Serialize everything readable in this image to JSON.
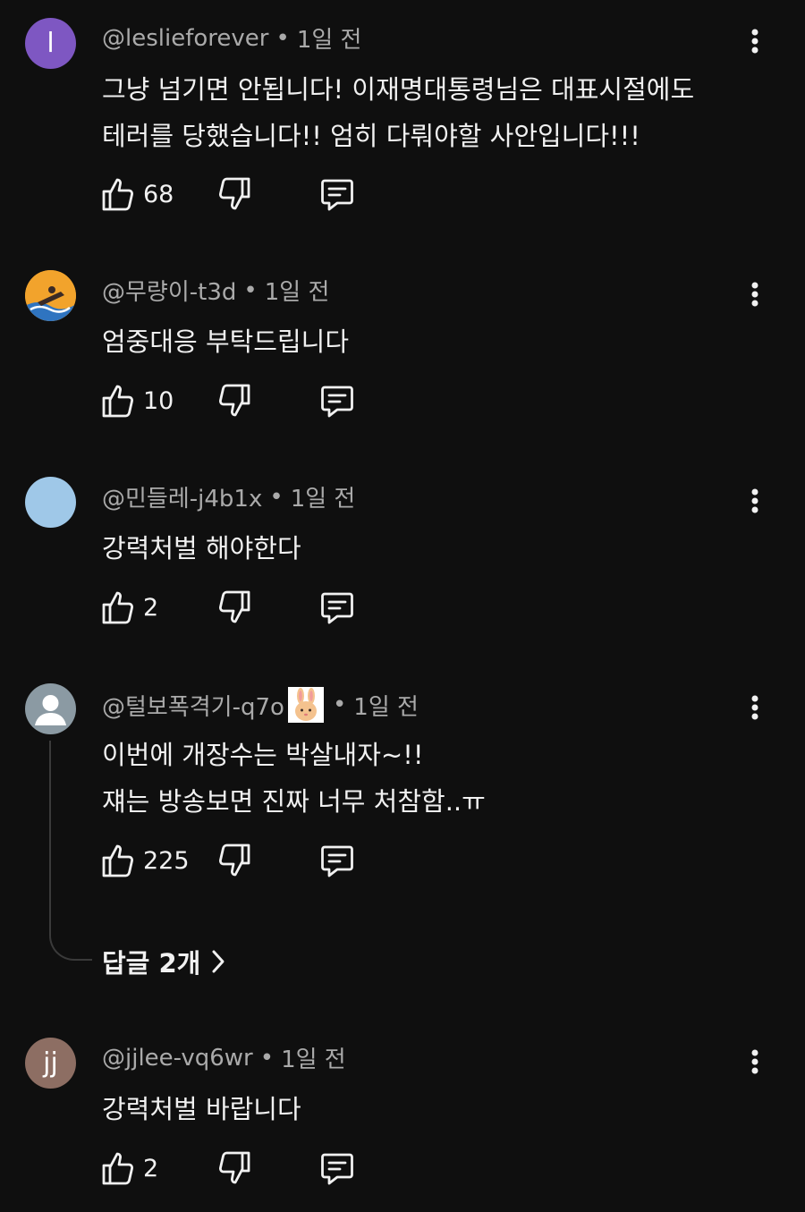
{
  "comments": [
    {
      "handle": "@leslieforever",
      "time": "1일 전",
      "avatar_letter": "l",
      "avatar_color": "#7e57c2",
      "text_lines": [
        "그냥 넘기면 안됩니다! 이재명대통령님은 대표시절에도",
        "테러를 당했습니다!! 엄히 다뤄야할 사안입니다!!!"
      ],
      "likes": "68"
    },
    {
      "handle": "@무량이-t3d",
      "time": "1일 전",
      "avatar_color": "#f2a32c",
      "text_lines": [
        "엄중대응 부탁드립니다"
      ],
      "likes": "10"
    },
    {
      "handle": "@민들레-j4b1x",
      "time": "1일 전",
      "avatar_color": "#9fc8e8",
      "text_lines": [
        "강력처벌 해야한다"
      ],
      "likes": "2"
    },
    {
      "handle": "@털보폭격기-q7o",
      "time": "1일 전",
      "avatar_color": "#8b9aa3",
      "text_lines": [
        "이번에 개장수는 박살내자~!!",
        "쟤는 방송보면 진짜 너무 처참함..ㅠ"
      ],
      "likes": "225",
      "replies_label": "답글 2개"
    },
    {
      "handle": "@jjlee-vq6wr",
      "time": "1일 전",
      "avatar_letter": "jj",
      "avatar_color": "#8d6e63",
      "text_lines": [
        "강력처벌 바랍니다"
      ],
      "likes": "2"
    }
  ],
  "separator": "•",
  "icons": {
    "like": "thumbs-up-icon",
    "dislike": "thumbs-down-icon",
    "reply": "comment-reply-icon",
    "menu": "more-vertical-icon",
    "chevron": "chevron-right-icon"
  },
  "colors": {
    "background": "#0f0f0f",
    "text": "#f1f1f1",
    "meta": "#aaaaaa"
  }
}
